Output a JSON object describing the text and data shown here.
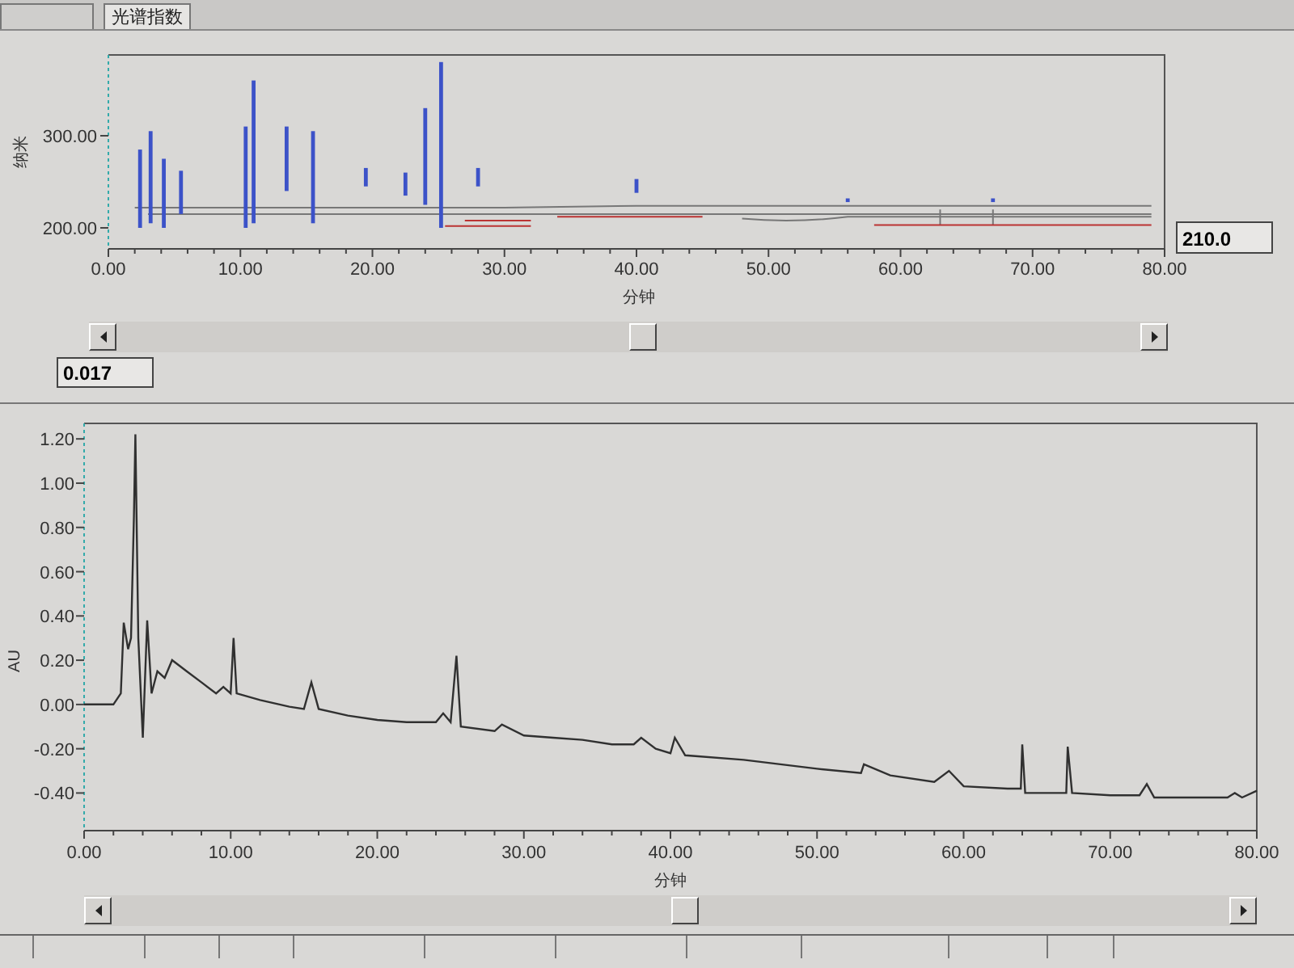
{
  "tabs": [
    {
      "selected": false
    },
    {
      "label": "光谱指数",
      "selected": true
    }
  ],
  "spectrum_map": {
    "y_label": "纳米",
    "y_ticks": [
      "300.00",
      "200.00"
    ],
    "x_ticks": [
      "0.00",
      "10.00",
      "20.00",
      "30.00",
      "40.00",
      "50.00",
      "60.00",
      "70.00",
      "80.00"
    ],
    "x_label": "分钟",
    "wavelength": "210.0"
  },
  "absorbance_reading": "0.017",
  "chromatogram": {
    "chart_data": {
      "type": "line",
      "xlabel": "分钟",
      "ylabel": "AU",
      "xlim": [
        0,
        80
      ],
      "ylim": [
        -0.57,
        1.27
      ],
      "xticks": [
        {
          "value": 0,
          "label": "0.00"
        },
        {
          "value": 10,
          "label": "10.00"
        },
        {
          "value": 20,
          "label": "20.00"
        },
        {
          "value": 30,
          "label": "30.00"
        },
        {
          "value": 40,
          "label": "40.00"
        },
        {
          "value": 50,
          "label": "50.00"
        },
        {
          "value": 60,
          "label": "60.00"
        },
        {
          "value": 70,
          "label": "70.00"
        },
        {
          "value": 80,
          "label": "80.00"
        }
      ],
      "yticks": [
        {
          "value": -0.4,
          "label": "-0.40"
        },
        {
          "value": -0.2,
          "label": "-0.20"
        },
        {
          "value": 0,
          "label": "0.00"
        },
        {
          "value": 0.2,
          "label": "0.20"
        },
        {
          "value": 0.4,
          "label": "0.40"
        },
        {
          "value": 0.6,
          "label": "0.60"
        },
        {
          "value": 0.8,
          "label": "0.80"
        },
        {
          "value": 1.0,
          "label": "1.00"
        },
        {
          "value": 1.2,
          "label": "1.20"
        }
      ],
      "x": [
        0,
        2,
        2.5,
        2.7,
        3,
        3.2,
        3.4,
        3.5,
        3.7,
        4,
        4.3,
        4.6,
        5,
        5.5,
        6,
        7,
        8,
        9,
        9.5,
        10,
        10.2,
        10.4,
        12,
        14,
        15,
        15.5,
        16,
        18,
        20,
        22,
        24,
        24.5,
        25,
        25.4,
        25.7,
        28,
        28.5,
        30,
        32,
        34,
        36,
        37.5,
        38,
        39,
        40,
        40.3,
        41,
        45,
        50,
        53,
        53.2,
        55,
        58,
        59,
        60,
        63,
        63.9,
        64,
        64.2,
        66,
        67,
        67.1,
        67.4,
        70,
        72,
        72.5,
        73,
        78,
        78.5,
        79,
        80
      ],
      "series": [
        {
          "color": "#303030",
          "values": [
            0,
            0,
            0.05,
            0.37,
            0.25,
            0.3,
            0.85,
            1.22,
            0.3,
            -0.15,
            0.38,
            0.05,
            0.15,
            0.12,
            0.2,
            0.15,
            0.1,
            0.05,
            0.08,
            0.05,
            0.3,
            0.05,
            0.02,
            -0.01,
            -0.02,
            0.1,
            -0.02,
            -0.05,
            -0.07,
            -0.08,
            -0.08,
            -0.04,
            -0.08,
            0.22,
            -0.1,
            -0.12,
            -0.09,
            -0.14,
            -0.15,
            -0.16,
            -0.18,
            -0.18,
            -0.15,
            -0.2,
            -0.22,
            -0.15,
            -0.23,
            -0.25,
            -0.29,
            -0.31,
            -0.27,
            -0.32,
            -0.35,
            -0.3,
            -0.37,
            -0.38,
            -0.38,
            -0.18,
            -0.4,
            -0.4,
            -0.4,
            -0.19,
            -0.4,
            -0.41,
            -0.41,
            -0.36,
            -0.42,
            -0.42,
            -0.4,
            -0.42,
            -0.39
          ]
        }
      ]
    }
  }
}
